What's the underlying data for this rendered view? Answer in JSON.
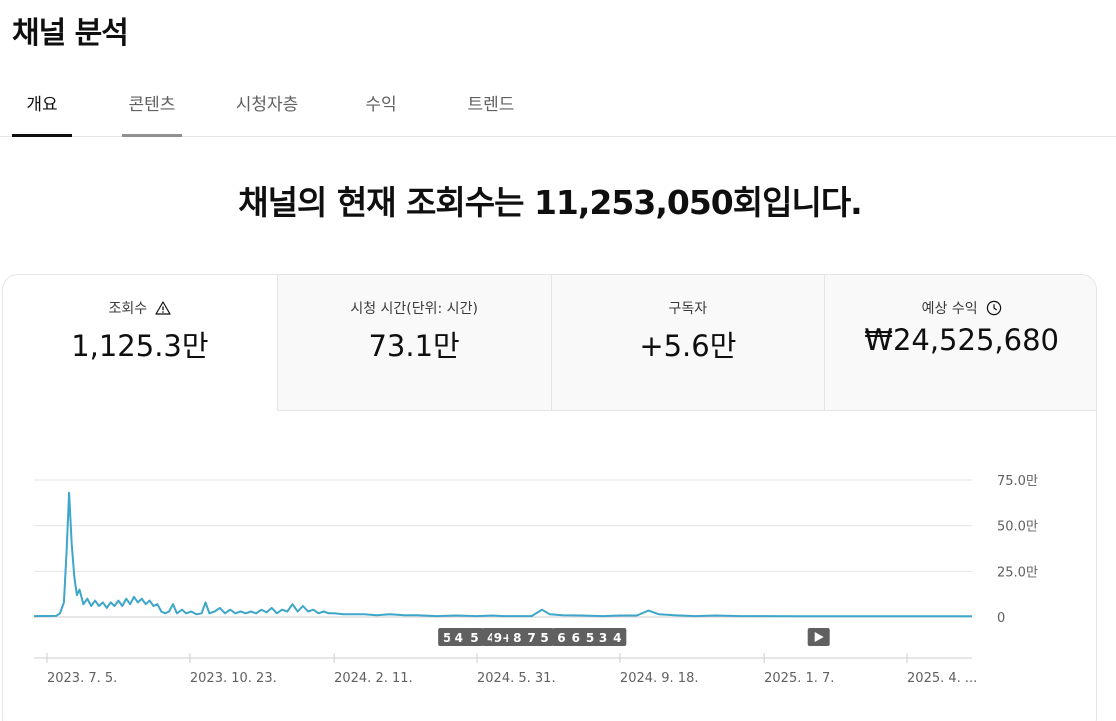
{
  "page": {
    "title": "채널 분석"
  },
  "tabs": [
    {
      "label": "개요",
      "state": "active"
    },
    {
      "label": "콘텐츠",
      "state": "hover"
    },
    {
      "label": "시청자층",
      "state": ""
    },
    {
      "label": "수익",
      "state": ""
    },
    {
      "label": "트렌드",
      "state": ""
    }
  ],
  "headline": "채널의 현재 조회수는 11,253,050회입니다.",
  "metrics": [
    {
      "label": "조회수",
      "value": "1,125.3만",
      "icon": "warning-icon",
      "selected": true
    },
    {
      "label": "시청 시간(단위: 시간)",
      "value": "73.1만",
      "icon": "",
      "selected": false
    },
    {
      "label": "구독자",
      "value": "+5.6만",
      "icon": "",
      "selected": false
    },
    {
      "label": "예상 수익",
      "value": "₩24,525,680",
      "icon": "clock-icon",
      "selected": false
    }
  ],
  "colors": {
    "line": "#3ea6c8",
    "grid": "#e5e5e5",
    "marker_bg": "#606060",
    "text": "#0f0f0f"
  },
  "chart_data": {
    "type": "line",
    "ylim": [
      0,
      75
    ],
    "yticks": [
      {
        "value": 75,
        "label": "75.0만"
      },
      {
        "value": 50,
        "label": "50.0만"
      },
      {
        "value": 25,
        "label": "25.0만"
      },
      {
        "value": 0,
        "label": "0"
      }
    ],
    "xlim": [
      "2023-06-25",
      "2025-06-16"
    ],
    "xtick_labels": [
      {
        "date": "2023-07-05",
        "label": "2023. 7. 5."
      },
      {
        "date": "2023-10-23",
        "label": "2023. 10. 23."
      },
      {
        "date": "2024-02-11",
        "label": "2024. 2. 11."
      },
      {
        "date": "2024-05-31",
        "label": "2024. 5. 31."
      },
      {
        "date": "2024-09-18",
        "label": "2024. 9. 18."
      },
      {
        "date": "2025-01-07",
        "label": "2025. 1. 7."
      },
      {
        "date": "2025-04-27",
        "label": "2025. 4. ..."
      }
    ],
    "y_unit": "만",
    "points": [
      [
        "2023-06-25",
        0.5
      ],
      [
        "2023-07-12",
        0.6
      ],
      [
        "2023-07-15",
        2
      ],
      [
        "2023-07-18",
        8
      ],
      [
        "2023-07-20",
        35
      ],
      [
        "2023-07-22",
        68
      ],
      [
        "2023-07-24",
        40
      ],
      [
        "2023-07-26",
        22
      ],
      [
        "2023-07-28",
        12
      ],
      [
        "2023-07-30",
        15
      ],
      [
        "2023-08-02",
        7
      ],
      [
        "2023-08-05",
        10
      ],
      [
        "2023-08-08",
        6
      ],
      [
        "2023-08-11",
        9
      ],
      [
        "2023-08-14",
        6
      ],
      [
        "2023-08-17",
        8
      ],
      [
        "2023-08-20",
        5
      ],
      [
        "2023-08-23",
        8
      ],
      [
        "2023-08-26",
        6
      ],
      [
        "2023-08-29",
        9
      ],
      [
        "2023-09-01",
        6
      ],
      [
        "2023-09-04",
        10
      ],
      [
        "2023-09-07",
        7
      ],
      [
        "2023-09-10",
        11
      ],
      [
        "2023-09-13",
        8
      ],
      [
        "2023-09-16",
        10
      ],
      [
        "2023-09-19",
        7
      ],
      [
        "2023-09-22",
        9
      ],
      [
        "2023-09-25",
        6
      ],
      [
        "2023-09-28",
        7
      ],
      [
        "2023-10-01",
        3
      ],
      [
        "2023-10-04",
        2
      ],
      [
        "2023-10-07",
        3
      ],
      [
        "2023-10-10",
        7
      ],
      [
        "2023-10-13",
        2
      ],
      [
        "2023-10-17",
        4
      ],
      [
        "2023-10-20",
        2
      ],
      [
        "2023-10-24",
        3
      ],
      [
        "2023-10-28",
        1.5
      ],
      [
        "2023-11-01",
        2
      ],
      [
        "2023-11-04",
        8
      ],
      [
        "2023-11-07",
        2
      ],
      [
        "2023-11-11",
        3
      ],
      [
        "2023-11-15",
        5
      ],
      [
        "2023-11-19",
        2
      ],
      [
        "2023-11-23",
        4
      ],
      [
        "2023-11-27",
        2
      ],
      [
        "2023-12-01",
        3
      ],
      [
        "2023-12-05",
        2
      ],
      [
        "2023-12-09",
        3
      ],
      [
        "2023-12-13",
        2
      ],
      [
        "2023-12-17",
        4
      ],
      [
        "2023-12-21",
        2.5
      ],
      [
        "2023-12-25",
        5
      ],
      [
        "2023-12-29",
        2
      ],
      [
        "2024-01-02",
        4
      ],
      [
        "2024-01-06",
        3
      ],
      [
        "2024-01-10",
        7
      ],
      [
        "2024-01-14",
        3
      ],
      [
        "2024-01-18",
        6
      ],
      [
        "2024-01-22",
        3
      ],
      [
        "2024-01-26",
        4
      ],
      [
        "2024-01-30",
        2
      ],
      [
        "2024-02-03",
        3
      ],
      [
        "2024-02-07",
        2
      ],
      [
        "2024-02-11",
        2
      ],
      [
        "2024-02-18",
        1.5
      ],
      [
        "2024-02-25",
        1.5
      ],
      [
        "2024-03-05",
        1.5
      ],
      [
        "2024-03-15",
        1
      ],
      [
        "2024-03-25",
        1.5
      ],
      [
        "2024-04-05",
        1
      ],
      [
        "2024-04-15",
        1
      ],
      [
        "2024-04-30",
        0.5
      ],
      [
        "2024-05-15",
        0.8
      ],
      [
        "2024-05-31",
        0.5
      ],
      [
        "2024-06-12",
        0.8
      ],
      [
        "2024-06-20",
        0.5
      ],
      [
        "2024-07-01",
        0.5
      ],
      [
        "2024-07-12",
        0.5
      ],
      [
        "2024-07-20",
        4
      ],
      [
        "2024-07-26",
        1.5
      ],
      [
        "2024-08-05",
        1
      ],
      [
        "2024-08-20",
        0.8
      ],
      [
        "2024-09-05",
        0.5
      ],
      [
        "2024-09-18",
        0.8
      ],
      [
        "2024-10-01",
        0.8
      ],
      [
        "2024-10-10",
        3.5
      ],
      [
        "2024-10-18",
        1.5
      ],
      [
        "2024-10-30",
        1
      ],
      [
        "2024-11-15",
        0.5
      ],
      [
        "2024-12-01",
        0.8
      ],
      [
        "2024-12-20",
        0.5
      ],
      [
        "2025-01-07",
        0.5
      ],
      [
        "2025-02-01",
        0.4
      ],
      [
        "2025-03-01",
        0.4
      ],
      [
        "2025-04-01",
        0.4
      ],
      [
        "2025-05-01",
        0.4
      ],
      [
        "2025-06-16",
        0.4
      ]
    ],
    "event_markers": [
      {
        "date": "2024-05-08",
        "label": "5"
      },
      {
        "date": "2024-05-17",
        "label": "4"
      },
      {
        "date": "2024-05-29",
        "label": "5"
      },
      {
        "date": "2024-06-11",
        "label": "4"
      },
      {
        "date": "2024-06-20",
        "label": "9+"
      },
      {
        "date": "2024-07-01",
        "label": "8"
      },
      {
        "date": "2024-07-12",
        "label": "7"
      },
      {
        "date": "2024-07-22",
        "label": "5"
      },
      {
        "date": "2024-08-04",
        "label": "6"
      },
      {
        "date": "2024-08-15",
        "label": "6"
      },
      {
        "date": "2024-08-26",
        "label": "5"
      },
      {
        "date": "2024-09-05",
        "label": "3"
      },
      {
        "date": "2024-09-16",
        "label": "4"
      },
      {
        "date": "2025-02-18",
        "label": "play",
        "icon": "play-icon"
      }
    ]
  }
}
